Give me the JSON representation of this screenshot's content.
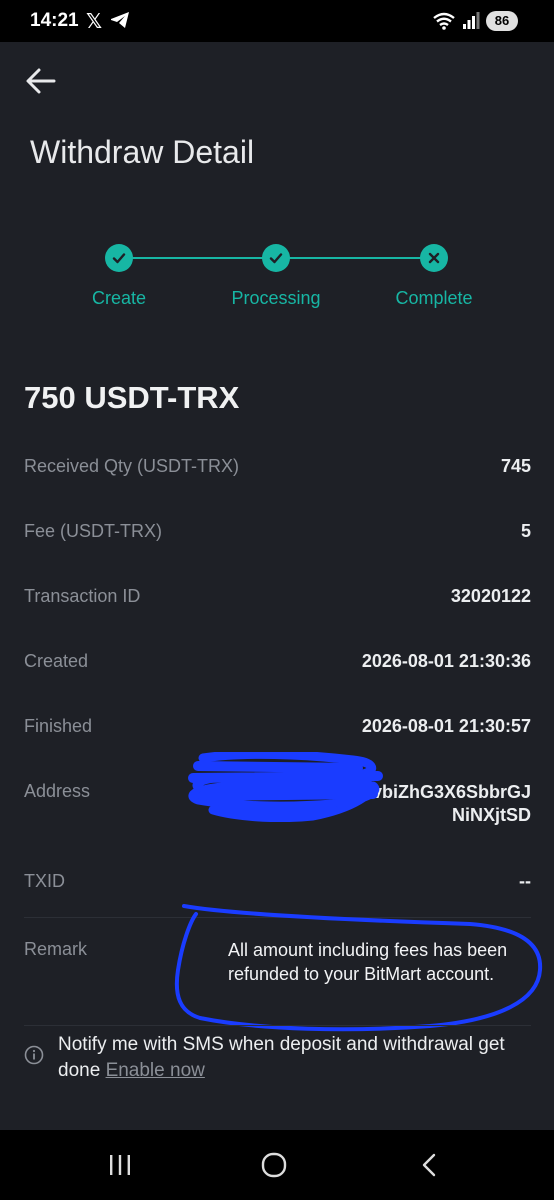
{
  "status_bar": {
    "time": "14:21",
    "x_glyph": "𝕏",
    "battery": "86"
  },
  "header": {
    "title": "Withdraw Detail"
  },
  "steps": [
    {
      "label": "Create",
      "state": "done",
      "icon": "check-icon"
    },
    {
      "label": "Processing",
      "state": "done",
      "icon": "check-icon"
    },
    {
      "label": "Complete",
      "state": "failed",
      "icon": "x-icon"
    }
  ],
  "amount": "750 USDT-TRX",
  "rows": [
    {
      "label": "Received Qty (USDT-TRX)",
      "value": "745"
    },
    {
      "label": "Fee (USDT-TRX)",
      "value": "5"
    },
    {
      "label": "Transaction ID",
      "value": "32020122"
    },
    {
      "label": "Created",
      "value": "2026-08-01 21:30:36"
    },
    {
      "label": "Finished",
      "value": "2026-08-01 21:30:57"
    }
  ],
  "address": {
    "label": "Address",
    "line1": "BvbiZhG3X6SbbrGJ",
    "line2": "NiNXjtSD"
  },
  "txid": {
    "label": "TXID",
    "value": "--"
  },
  "remark": {
    "label": "Remark",
    "value": "All amount including fees has been refunded to your BitMart account."
  },
  "notify": {
    "text": "Notify me with SMS when deposit and withdrawal get done",
    "link": "Enable now"
  },
  "colors": {
    "accent": "#17b6a4",
    "background": "#1e2026",
    "annotation": "#1a3cff"
  }
}
